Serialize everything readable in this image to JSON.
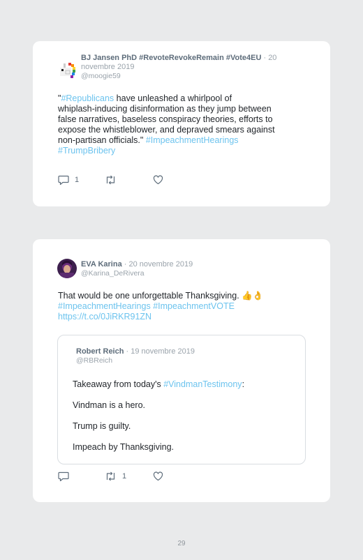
{
  "tweet1": {
    "author_name": "BJ Jansen PhD #RevoteRevokeRemain #Vote4EU",
    "date": "· 20 novembre 2019",
    "handle": "@moogie59",
    "text_parts": {
      "quote_open": "\"",
      "hashtag_republicans": "#Republicans",
      "line1_rest": " have unleashed a whirlpool of",
      "line2": "whiplash-inducing disinformation as they jump between",
      "line3": "false narratives, baseless conspiracy theories, efforts to",
      "line4": "expose the whistleblower, and depraved smears against",
      "line5_start": "non-partisan officials.\" ",
      "hashtag_impeachment": "#ImpeachmentHearings",
      "hashtag_trumpbribery": "#TrumpBribery"
    },
    "reply_count": "1",
    "retweet_count": "",
    "like_count": ""
  },
  "tweet2": {
    "author_name": "EVA Karina",
    "date": "· 20 novembre 2019",
    "handle": "@Karina_DeRivera",
    "text_line1": "That would be one unforgettable Thanksgiving. 👍👌",
    "hashtag_impeachment": "#ImpeachmentHearings",
    "hashtag_vote": "#ImpeachmentVOTE",
    "link": "https://t.co/0JiRKR91ZN",
    "reply_count": "",
    "retweet_count": "1",
    "like_count": "",
    "quoted": {
      "author_name": "Robert Reich",
      "date": "· 19 novembre 2019",
      "handle": "@RBReich",
      "line1_start": "Takeaway from today's ",
      "hashtag_vindman": "#VindmanTestimony",
      "line1_end": ":",
      "line2": "Vindman is a hero.",
      "line3": "Trump is guilty.",
      "line4": "Impeach by Thanksgiving."
    }
  },
  "page_number": "29",
  "colors": {
    "link": "#6cc3ee",
    "name": "#5d6c7a",
    "meta": "#9aa3ab",
    "background": "#e9eaeb"
  }
}
